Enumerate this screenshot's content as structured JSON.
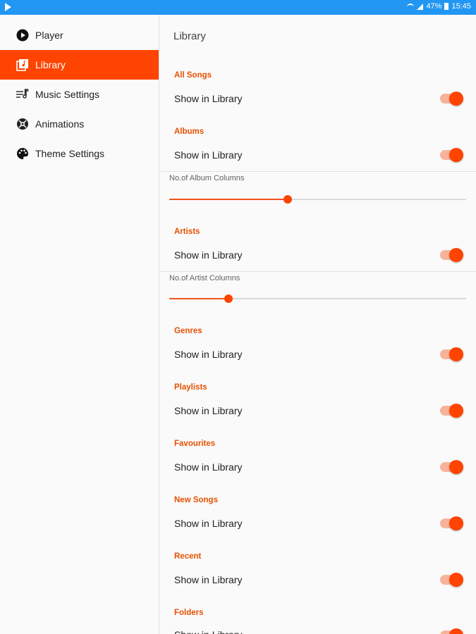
{
  "status_bar": {
    "battery": "47%",
    "time": "15:45"
  },
  "sidebar": {
    "items": [
      {
        "label": "Player",
        "icon": "play-circle-icon"
      },
      {
        "label": "Library",
        "icon": "library-icon",
        "active": true
      },
      {
        "label": "Music Settings",
        "icon": "music-settings-icon"
      },
      {
        "label": "Animations",
        "icon": "animations-icon"
      },
      {
        "label": "Theme Settings",
        "icon": "palette-icon"
      }
    ]
  },
  "main": {
    "title": "Library",
    "show_label": "Show in Library",
    "sections": [
      {
        "name": "All Songs",
        "enabled": true
      },
      {
        "name": "Albums",
        "enabled": true,
        "slider_label": "No.of Album Columns",
        "slider_fraction": 0.4
      },
      {
        "name": "Artists",
        "enabled": true,
        "slider_label": "No.of Artist Columns",
        "slider_fraction": 0.2
      },
      {
        "name": "Genres",
        "enabled": true
      },
      {
        "name": "Playlists",
        "enabled": true
      },
      {
        "name": "Favourites",
        "enabled": true
      },
      {
        "name": "New Songs",
        "enabled": true
      },
      {
        "name": "Recent",
        "enabled": true
      },
      {
        "name": "Folders",
        "enabled": true
      }
    ]
  },
  "colors": {
    "accent": "#fe4400",
    "status_bar": "#2196f3",
    "category_text": "#e65100",
    "toggle_track": "#f7b39a"
  }
}
